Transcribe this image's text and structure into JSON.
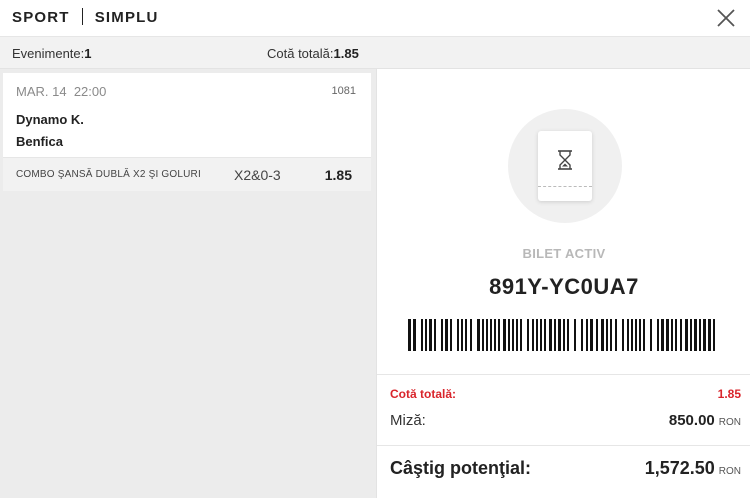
{
  "header": {
    "sport": "SPORT",
    "type": "SIMPLU"
  },
  "summary": {
    "events_label": "Evenimente:",
    "events_value": "1",
    "total_odds_label": "Cotă totală:",
    "total_odds_value": "1.85"
  },
  "bet": {
    "date": "MAR. 14",
    "time": "22:00",
    "code": "1081",
    "home_team": "Dynamo K.",
    "away_team": "Benfica",
    "market": "COMBO ŞANSĂ DUBLĂ X2 ŞI GOLURI",
    "pick": "X2&0-3",
    "odds": "1.85"
  },
  "ticket": {
    "status": "BILET ACTIV",
    "code": "891Y-YC0UA7",
    "icon": "hourglass-icon"
  },
  "totals": {
    "total_odds_label": "Cotă totală:",
    "total_odds_value": "1.85",
    "stake_label": "Miză:",
    "stake_value": "850.00",
    "currency": "RON",
    "potential_win_label": "Câştig potenţial:",
    "potential_win_value": "1,572.50"
  },
  "colors": {
    "accent_red": "#d9242b",
    "panel_gray": "#ececec"
  }
}
